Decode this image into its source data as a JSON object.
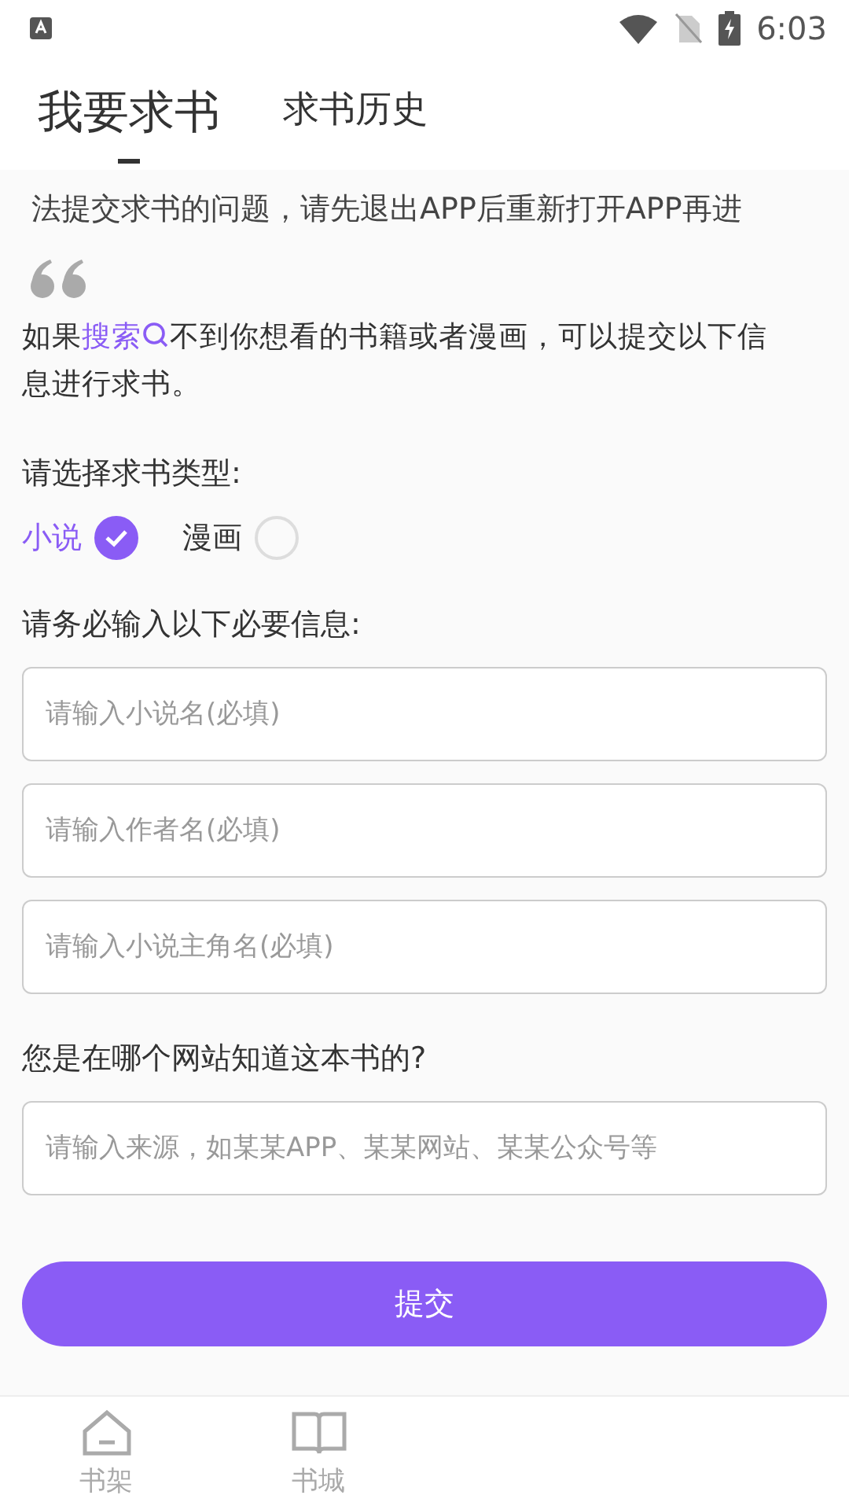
{
  "status_bar": {
    "time": "6:03"
  },
  "tabs": [
    {
      "label": "我要求书",
      "selected": true
    },
    {
      "label": "求书历史",
      "selected": false
    }
  ],
  "notice": "法提交求书的问题，请先退出APP后重新打开APP再进",
  "intro": {
    "before": "如果",
    "link": "搜索",
    "after": "不到你想看的书籍或者漫画，可以提交以下信息进行求书。"
  },
  "type_prompt": "请选择求书类型:",
  "types": [
    {
      "label": "小说",
      "selected": true
    },
    {
      "label": "漫画",
      "selected": false
    }
  ],
  "required_prompt": "请务必输入以下必要信息:",
  "required_fields": [
    {
      "placeholder": "请输入小说名(必填)"
    },
    {
      "placeholder": "请输入作者名(必填)"
    },
    {
      "placeholder": "请输入小说主角名(必填)"
    }
  ],
  "source_prompt": "您是在哪个网站知道这本书的?",
  "source_field": {
    "placeholder": "请输入来源，如某某APP、某某网站、某某公众号等"
  },
  "submit": "提交",
  "nav": [
    {
      "label": "书架",
      "kind": "shelf"
    },
    {
      "label": "书城",
      "kind": "store"
    }
  ]
}
